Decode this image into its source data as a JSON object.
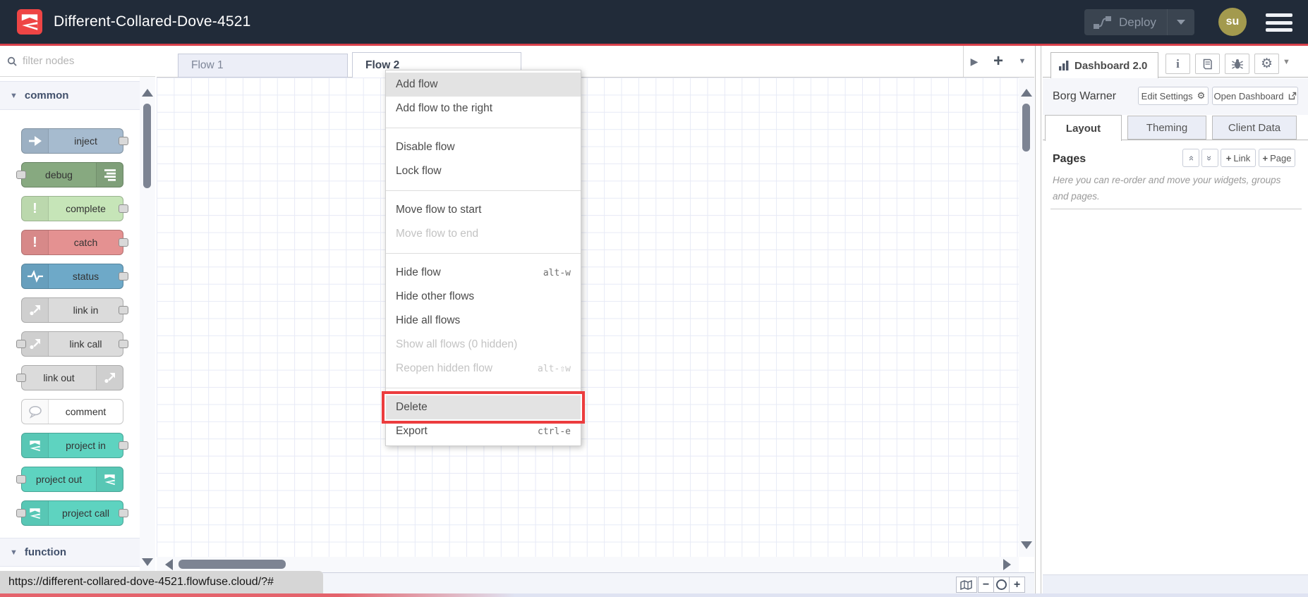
{
  "header": {
    "title": "Different-Collared-Dove-4521",
    "deploy_label": "Deploy",
    "avatar_initials": "su"
  },
  "palette": {
    "filter_placeholder": "filter nodes",
    "category_common": "common",
    "category_function": "function",
    "nodes": [
      {
        "label": "inject",
        "color": "#a6bbcf",
        "icon": "inject-arrow-icon",
        "icon_side": "left",
        "ports": "right"
      },
      {
        "label": "debug",
        "color": "#87a980",
        "icon": "debug-lines-icon",
        "icon_side": "right",
        "ports": "left"
      },
      {
        "label": "complete",
        "color": "#c6e5b8",
        "icon": "exclamation-icon",
        "icon_side": "left",
        "ports": "right"
      },
      {
        "label": "catch",
        "color": "#e49191",
        "icon": "exclamation-icon",
        "icon_side": "left",
        "ports": "right"
      },
      {
        "label": "status",
        "color": "#6ea9c8",
        "icon": "status-pulse-icon",
        "icon_side": "left",
        "ports": "right"
      },
      {
        "label": "link in",
        "color": "#dbdbdb",
        "icon": "link-icon",
        "icon_side": "left",
        "ports": "right"
      },
      {
        "label": "link call",
        "color": "#dbdbdb",
        "icon": "link-icon",
        "icon_side": "left",
        "ports": "both"
      },
      {
        "label": "link out",
        "color": "#dbdbdb",
        "icon": "link-icon",
        "icon_side": "right",
        "ports": "left"
      },
      {
        "label": "comment",
        "color": "#ffffff",
        "icon": "comment-bubble-icon",
        "icon_side": "left",
        "ports": "none"
      },
      {
        "label": "project in",
        "color": "#5ed3c0",
        "icon": "flowfuse-icon",
        "icon_side": "left",
        "ports": "right"
      },
      {
        "label": "project out",
        "color": "#5ed3c0",
        "icon": "flowfuse-icon",
        "icon_side": "right",
        "ports": "left"
      },
      {
        "label": "project call",
        "color": "#5ed3c0",
        "icon": "flowfuse-icon",
        "icon_side": "left",
        "ports": "both"
      }
    ]
  },
  "workspace": {
    "tabs": [
      {
        "label": "Flow 1",
        "active": false
      },
      {
        "label": "Flow 2",
        "active": true
      }
    ]
  },
  "context_menu": {
    "items": [
      {
        "label": "Add flow",
        "highlighted": true
      },
      {
        "label": "Add flow to the right"
      },
      {
        "separator": true
      },
      {
        "label": "Disable flow"
      },
      {
        "label": "Lock flow"
      },
      {
        "separator": true
      },
      {
        "label": "Move flow to start"
      },
      {
        "label": "Move flow to end",
        "disabled": true
      },
      {
        "separator": true
      },
      {
        "label": "Hide flow",
        "shortcut": "alt-w"
      },
      {
        "label": "Hide other flows"
      },
      {
        "label": "Hide all flows"
      },
      {
        "label": "Show all flows (0 hidden)",
        "disabled": true
      },
      {
        "label": "Reopen hidden flow",
        "shortcut": "alt-⇧w",
        "disabled": true
      },
      {
        "separator": true
      },
      {
        "label": "Delete",
        "highlighted": true,
        "annotated": true
      },
      {
        "label": "Export",
        "shortcut": "ctrl-e"
      }
    ],
    "annotation_color": "#ec3c3e"
  },
  "sidebar": {
    "dashboard_tab": "Dashboard 2.0",
    "instance_name": "Borg Warner",
    "edit_settings_label": "Edit Settings",
    "open_dashboard_label": "Open Dashboard",
    "tabs": [
      {
        "label": "Layout",
        "active": true
      },
      {
        "label": "Theming",
        "active": false
      },
      {
        "label": "Client Data",
        "active": false
      }
    ],
    "pages_title": "Pages",
    "add_link_label": "Link",
    "add_page_label": "Page",
    "plus_glyph": "+",
    "help_text": "Here you can re-order and move your widgets, groups and pages."
  },
  "statusbar": {
    "url": "https://different-collared-dove-4521.flowfuse.cloud/?#"
  },
  "colors": {
    "header_bg": "#212b39",
    "accent_red": "#d8404a",
    "logo_red": "#ee4545",
    "avatar_bg": "#a39a4e",
    "flowfuse_teal": "#5ed3c0"
  }
}
